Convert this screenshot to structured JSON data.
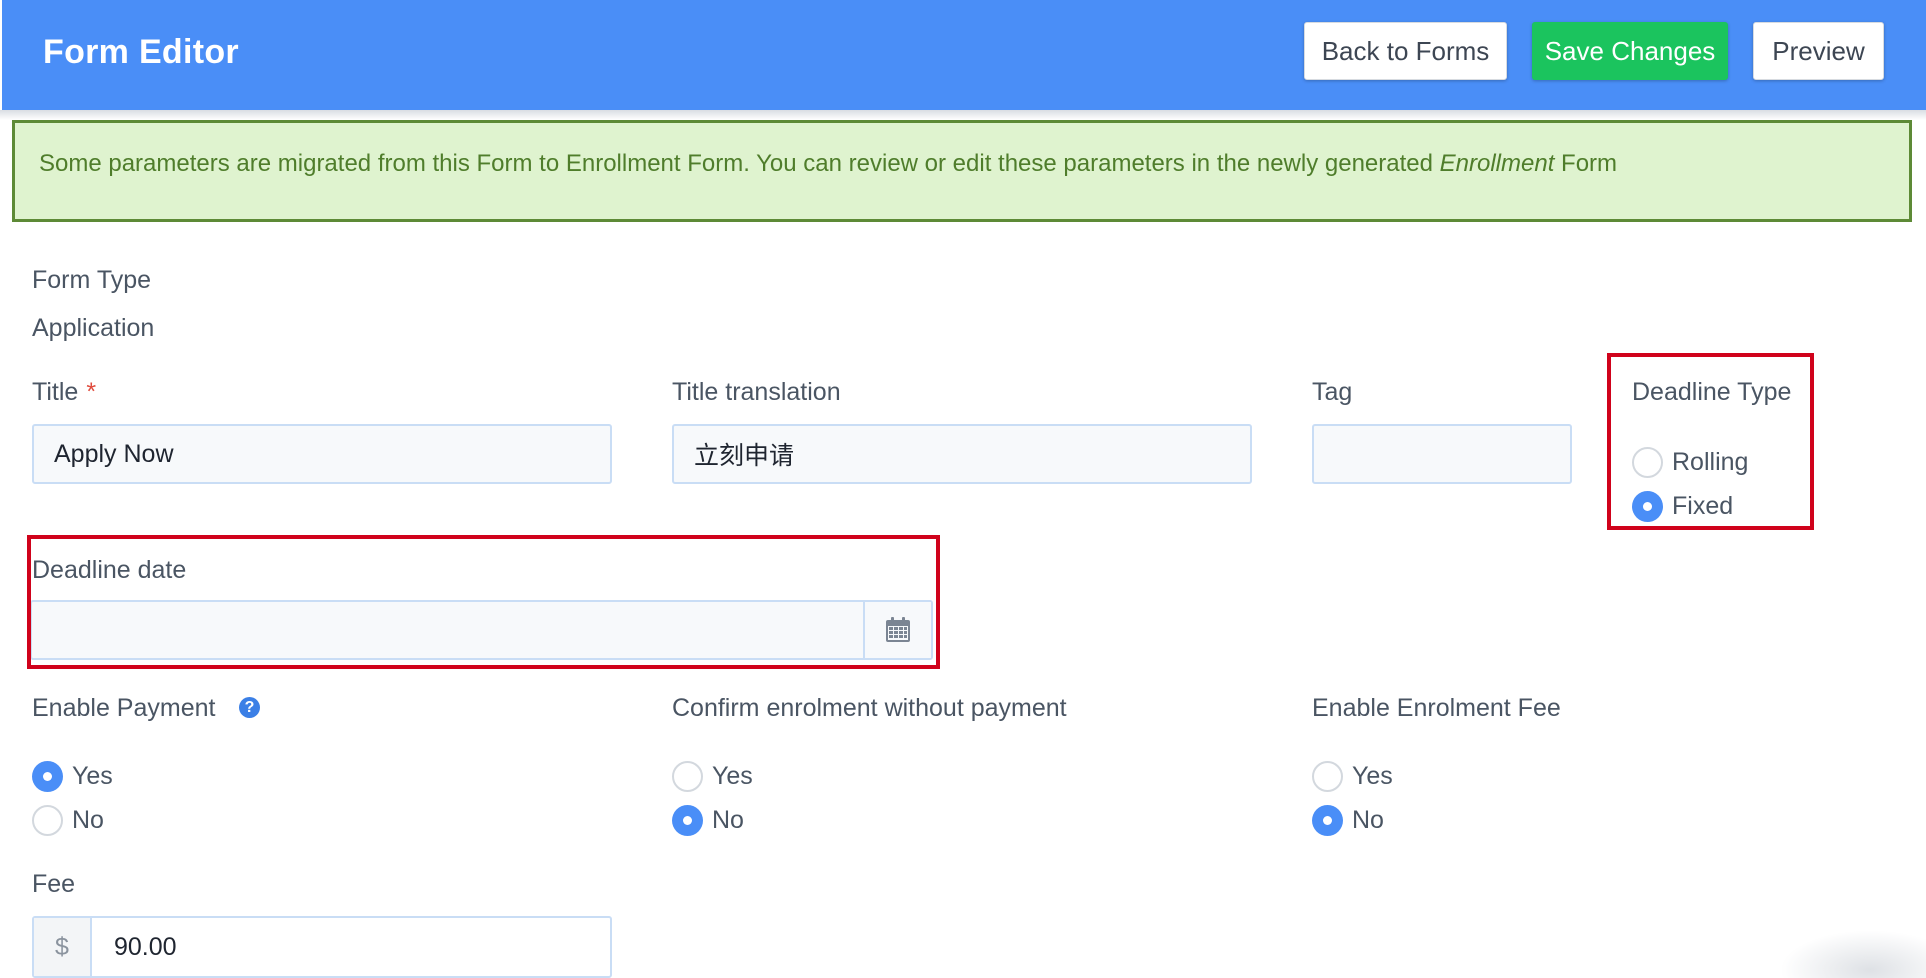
{
  "header": {
    "title": "Form Editor",
    "back_label": "Back to Forms",
    "save_label": "Save Changes",
    "preview_label": "Preview"
  },
  "alert": {
    "text_before": "Some parameters are migrated from this Form to Enrollment Form. You can review or edit these parameters in the newly generated ",
    "text_italic": "Enrollment",
    "text_after": " Form"
  },
  "form_type": {
    "label": "Form Type",
    "value": "Application"
  },
  "title_field": {
    "label": "Title",
    "required_mark": "*",
    "value": "Apply Now"
  },
  "title_translation": {
    "label": "Title translation",
    "value": "立刻申请"
  },
  "tag": {
    "label": "Tag",
    "value": ""
  },
  "deadline_type": {
    "label": "Deadline Type",
    "options": [
      "Rolling",
      "Fixed"
    ],
    "selected": "Fixed"
  },
  "deadline_date": {
    "label": "Deadline date",
    "value": "",
    "icon": "calendar-icon"
  },
  "enable_payment": {
    "label": "Enable Payment",
    "help_icon": "question-circle-icon",
    "help_glyph": "?",
    "options": [
      "Yes",
      "No"
    ],
    "selected": "Yes"
  },
  "confirm_without_payment": {
    "label": "Confirm enrolment without payment",
    "options": [
      "Yes",
      "No"
    ],
    "selected": "No"
  },
  "enable_enrolment_fee": {
    "label": "Enable Enrolment Fee",
    "options": [
      "Yes",
      "No"
    ],
    "selected": "No"
  },
  "fee": {
    "label": "Fee",
    "currency": "$",
    "value": "90.00"
  },
  "colors": {
    "header": "#4a8ef7",
    "save": "#1bc45e",
    "alert_bg": "#dff3cf",
    "alert_border": "#5d8a36",
    "highlight": "#d0021b",
    "radio_on": "#4a8ef7"
  }
}
